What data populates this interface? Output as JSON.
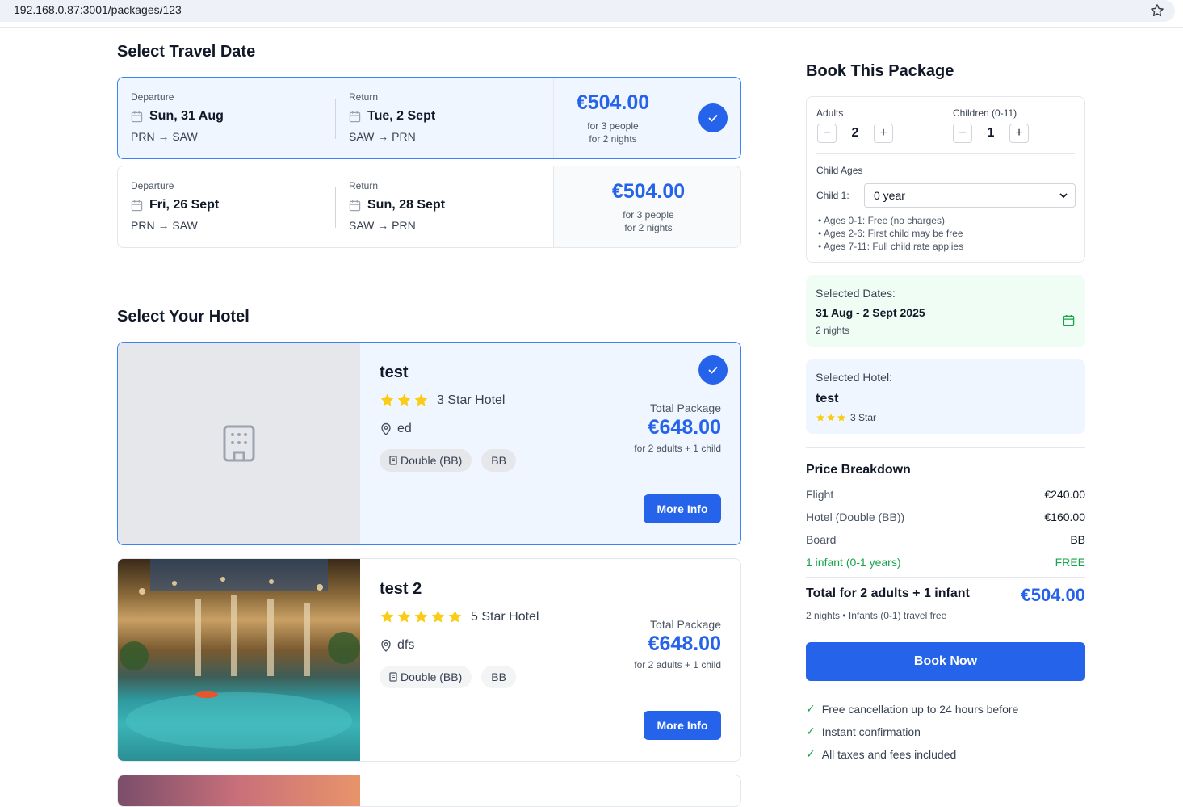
{
  "browser": {
    "url": "192.168.0.87:3001/packages/123"
  },
  "dates_section": {
    "title": "Select Travel Date",
    "cards": [
      {
        "departure_label": "Departure",
        "departure_date": "Sun, 31 Aug",
        "departure_route": "PRN → SAW",
        "return_label": "Return",
        "return_date": "Tue, 2 Sept",
        "return_route": "SAW → PRN",
        "price": "€504.00",
        "people": "for 3 people",
        "nights": "for 2 nights",
        "selected": true
      },
      {
        "departure_label": "Departure",
        "departure_date": "Fri, 26 Sept",
        "departure_route": "PRN → SAW",
        "return_label": "Return",
        "return_date": "Sun, 28 Sept",
        "return_route": "SAW → PRN",
        "price": "€504.00",
        "people": "for 3 people",
        "nights": "for 2 nights",
        "selected": false
      }
    ]
  },
  "hotels_section": {
    "title": "Select Your Hotel",
    "hotels": [
      {
        "name": "test",
        "stars": 3,
        "stars_label": "3 Star Hotel",
        "location": "ed",
        "room": "Double (BB)",
        "board": "BB",
        "total_label": "Total Package",
        "price": "€648.00",
        "for": "for 2 adults + 1 child",
        "button": "More Info",
        "selected": true,
        "image": "placeholder"
      },
      {
        "name": "test 2",
        "stars": 5,
        "stars_label": "5 Star Hotel",
        "location": "dfs",
        "room": "Double (BB)",
        "board": "BB",
        "total_label": "Total Package",
        "price": "€648.00",
        "for": "for 2 adults + 1 child",
        "button": "More Info",
        "selected": false,
        "image": "hotel-pool-photo"
      }
    ]
  },
  "booking": {
    "title": "Book This Package",
    "adults_label": "Adults",
    "adults": "2",
    "children_label": "Children (0-11)",
    "children": "1",
    "child_ages_label": "Child Ages",
    "child1_label": "Child 1:",
    "child1_value": "0 year",
    "notes": [
      "• Ages 0-1: Free (no charges)",
      "• Ages 2-6: First child may be free",
      "• Ages 7-11: Full child rate applies"
    ],
    "selected_dates_label": "Selected Dates:",
    "selected_dates": "31 Aug - 2 Sept 2025",
    "selected_nights": "2 nights",
    "selected_hotel_label": "Selected Hotel:",
    "selected_hotel": "test",
    "selected_hotel_stars": "3 Star",
    "price_breakdown_title": "Price Breakdown",
    "rows": [
      {
        "label": "Flight",
        "value": "€240.00"
      },
      {
        "label": "Hotel (Double (BB))",
        "value": "€160.00"
      },
      {
        "label": "Board",
        "value": "BB"
      },
      {
        "label": "1 infant (0-1 years)",
        "value": "FREE"
      }
    ],
    "total_label": "Total for 2 adults + 1 infant",
    "total_value": "€504.00",
    "total_sub": "2 nights • Infants (0-1) travel free",
    "book_button": "Book Now",
    "perks": [
      "Free cancellation up to 24 hours before",
      "Instant confirmation",
      "All taxes and fees included"
    ]
  },
  "colors": {
    "accent": "#2563eb",
    "selected_bg": "#eff6ff",
    "green": "#16a34a",
    "star": "#facc15"
  }
}
